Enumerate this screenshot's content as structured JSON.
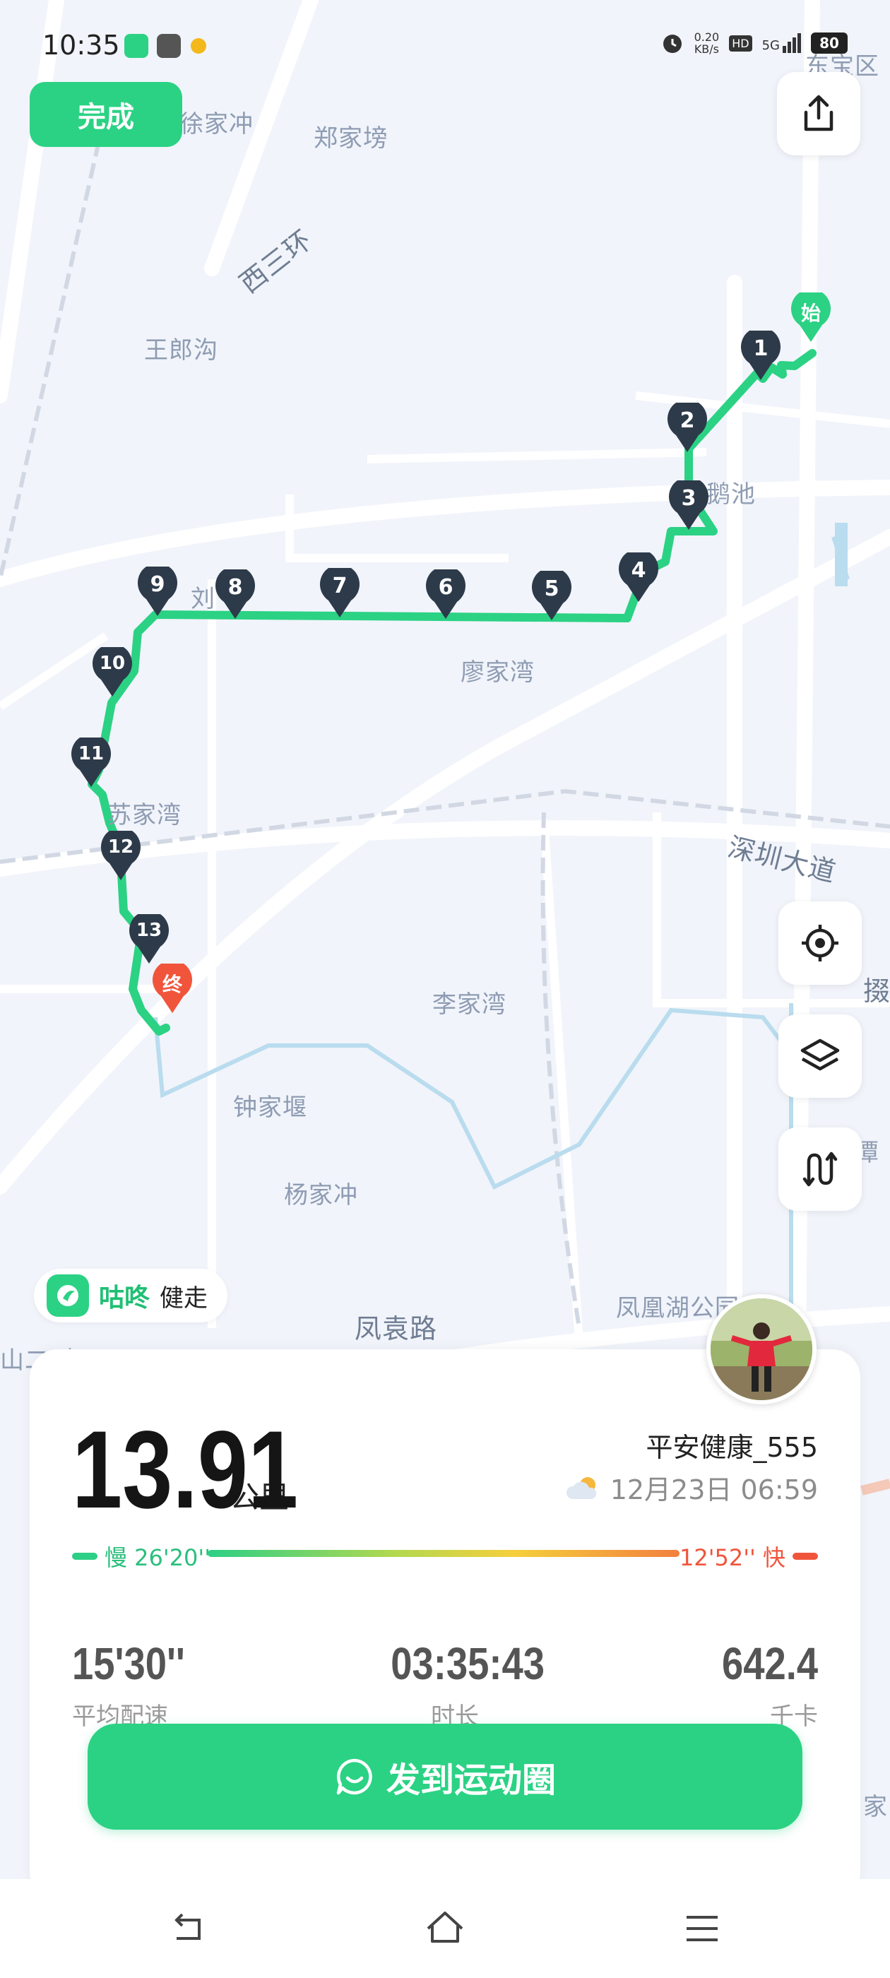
{
  "status_bar": {
    "time": "10:35",
    "net_speed_value": "0.20",
    "net_speed_unit": "KB/s",
    "hd": "HD",
    "network": "5G",
    "battery": "80"
  },
  "top": {
    "done_label": "完成",
    "share_icon": "share-icon"
  },
  "map": {
    "labels": {
      "xujiachong": "徐家冲",
      "zhengjiabang": "郑家塝",
      "xisanhuan": "西三环",
      "wanglanggou": "王郎沟",
      "epengchi": "鹅池",
      "liu": "刘",
      "liaojiawan": "廖家湾",
      "sujiawan": "苏家湾",
      "shenzhen_dadao": "深圳大道",
      "lijiawan": "李家湾",
      "zhongjiayan": "钟家堰",
      "yangjiachong": "杨家冲",
      "fengyuanlu": "凤袁路",
      "fenghuanghu": "凤凰湖公园",
      "dongbao": "东宝区",
      "tan": "潭",
      "tan2": "掇",
      "shan": "山二叫",
      "jia": "家"
    },
    "start_label": "始",
    "end_label": "终",
    "markers": [
      "1",
      "2",
      "3",
      "4",
      "5",
      "6",
      "7",
      "8",
      "9",
      "10",
      "11",
      "12",
      "13"
    ],
    "route_color": "#2bd284"
  },
  "controls": {
    "locate_icon": "locate-icon",
    "layers_icon": "layers-icon",
    "route_icon": "route-icon"
  },
  "brand": {
    "name": "咕咚",
    "sub": "健走"
  },
  "card": {
    "distance": "13.91",
    "distance_unit": "公里",
    "user_name": "平安健康_555",
    "date": "12月23日 06:59",
    "pace_slow_label": "慢 26'20''",
    "pace_fast_label": "12'52'' 快",
    "stats": [
      {
        "value": "15'30''",
        "label": "平均配速"
      },
      {
        "value": "03:35:43",
        "label": "时长"
      },
      {
        "value": "642.4",
        "label": "千卡"
      }
    ],
    "share_label": "发到运动圈"
  },
  "colors": {
    "accent": "#2bd284",
    "slow": "#2bbf7c",
    "fast": "#f0553c"
  }
}
